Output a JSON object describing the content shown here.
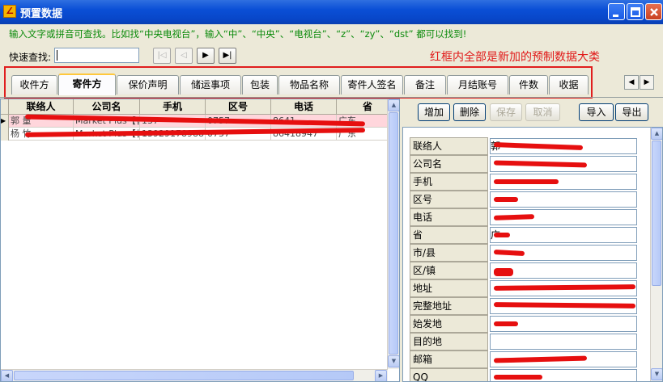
{
  "window": {
    "title": "预置数据",
    "app_icon": "app-logo-icon"
  },
  "hint": "输入文字或拼音可查找。比如找“中央电视台”，输入“中”、“中央”、“电视台”、“z”、“zy”、“dst” 都可以找到!",
  "search": {
    "label": "快速查找:",
    "value": ""
  },
  "annotation": "红框内全部是新加的预制数据大类",
  "tabs": [
    "收件方",
    "寄件方",
    "保价声明",
    "储运事项",
    "包装",
    "物品名称",
    "寄件人签名",
    "备注",
    "月结账号",
    "件数",
    "收据"
  ],
  "active_tab": "寄件方",
  "grid": {
    "columns": [
      "联络人",
      "公司名",
      "手机",
      "区号",
      "电话",
      "省"
    ],
    "rows": [
      [
        "郭 量",
        "Market Plus【香",
        "137",
        "0757",
        "8641",
        "广东"
      ],
      [
        "杨 竹",
        "Market Plus【香",
        "13929178988",
        "0757",
        "86418947",
        "广东"
      ]
    ]
  },
  "actions": {
    "add": "增加",
    "delete": "删除",
    "save": "保存",
    "cancel": "取消",
    "import": "导入",
    "export": "导出"
  },
  "form": {
    "fields": [
      {
        "label": "联络人",
        "value": "郭"
      },
      {
        "label": "公司名",
        "value": ""
      },
      {
        "label": "手机",
        "value": ""
      },
      {
        "label": "区号",
        "value": ""
      },
      {
        "label": "电话",
        "value": ""
      },
      {
        "label": "省",
        "value": "广"
      },
      {
        "label": "市/县",
        "value": ""
      },
      {
        "label": "区/镇",
        "value": ""
      },
      {
        "label": "地址",
        "value": ""
      },
      {
        "label": "完整地址",
        "value": ""
      },
      {
        "label": "始发地",
        "value": ""
      },
      {
        "label": "目的地",
        "value": ""
      },
      {
        "label": "邮箱",
        "value": ""
      },
      {
        "label": "QQ",
        "value": ""
      }
    ]
  },
  "colors": {
    "accent": "#0a4fd6",
    "hint": "#0a8a0a",
    "annotation": "#e11919",
    "selected_row": "#ffd6dc"
  }
}
